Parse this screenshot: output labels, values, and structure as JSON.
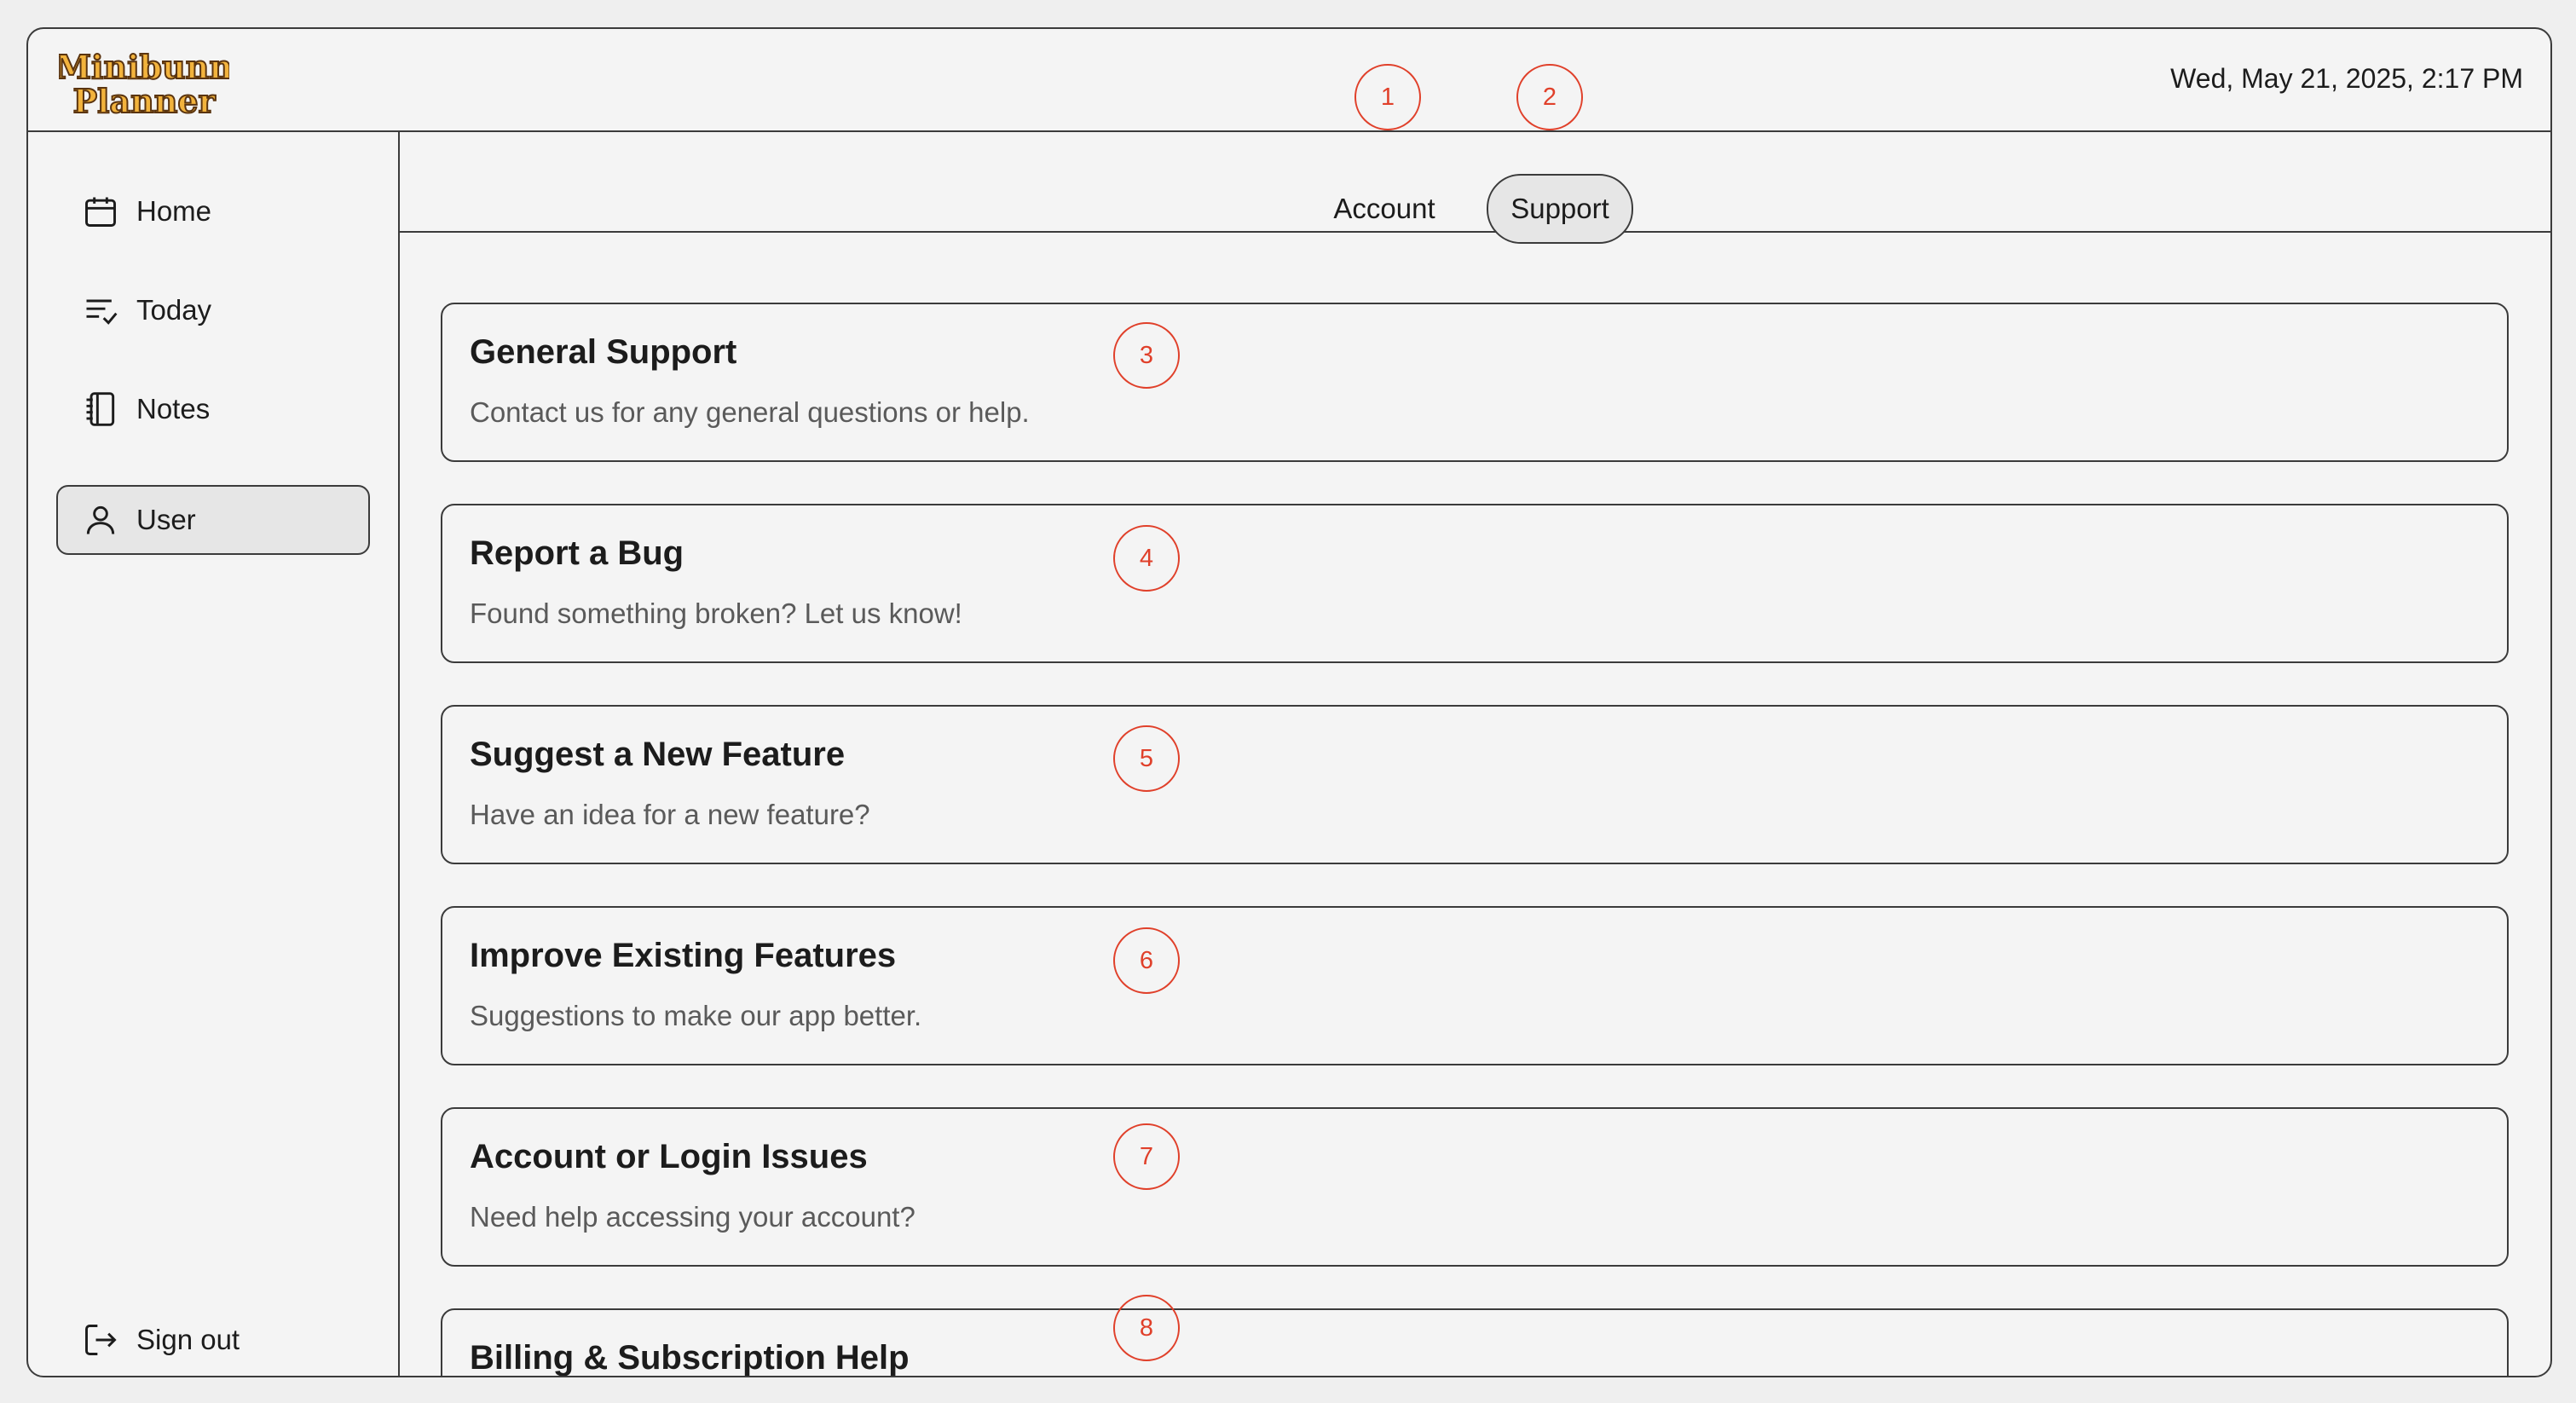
{
  "app": {
    "logo_line1": "Minibunn",
    "logo_line2": "Planner",
    "datetime": "Wed, May 21, 2025, 2:17 PM"
  },
  "sidebar": {
    "items": [
      {
        "label": "Home",
        "icon": "calendar-icon"
      },
      {
        "label": "Today",
        "icon": "checklist-icon"
      },
      {
        "label": "Notes",
        "icon": "notebook-icon"
      },
      {
        "label": "User",
        "icon": "user-icon",
        "active": true
      }
    ],
    "sign_out": {
      "label": "Sign out",
      "icon": "sign-out-icon"
    }
  },
  "tabs": [
    {
      "label": "Account",
      "active": false
    },
    {
      "label": "Support",
      "active": true
    }
  ],
  "cards": [
    {
      "title": "General Support",
      "description": "Contact us for any general questions or help."
    },
    {
      "title": "Report a Bug",
      "description": "Found something broken? Let us know!"
    },
    {
      "title": "Suggest a New Feature",
      "description": "Have an idea for a new feature?"
    },
    {
      "title": "Improve Existing Features",
      "description": "Suggestions to make our app better."
    },
    {
      "title": "Account or Login Issues",
      "description": "Need help accessing your account?"
    },
    {
      "title": "Billing & Subscription Help",
      "description": ""
    }
  ],
  "markers": [
    "1",
    "2",
    "3",
    "4",
    "5",
    "6",
    "7",
    "8"
  ],
  "colors": {
    "accent_marker": "#e0402a",
    "logo_fill": "#f2b33d",
    "logo_stroke": "#5a3410",
    "border": "#3b3b3b",
    "background": "#f4f4f4",
    "active_bg": "#e6e6e6"
  }
}
